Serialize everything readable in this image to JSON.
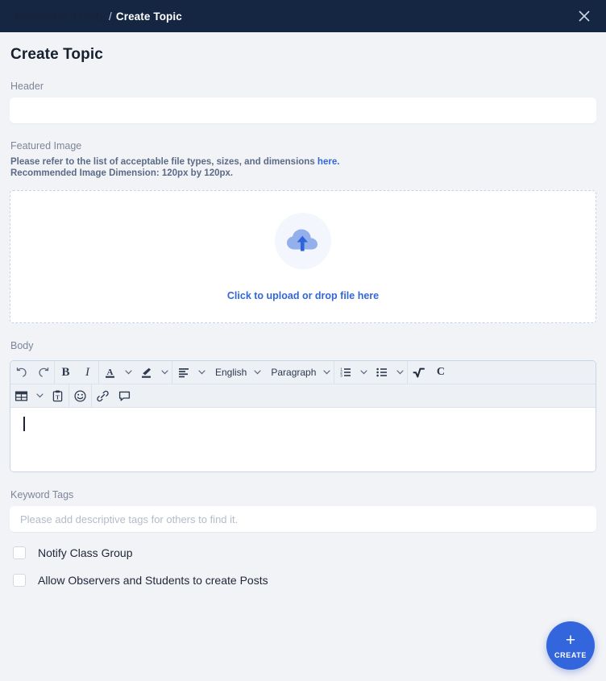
{
  "topbar": {
    "breadcrumb_parent": "Secondary 3 Unity",
    "breadcrumb_separator": "/",
    "breadcrumb_current": "Create Topic",
    "close_icon": "close-icon"
  },
  "page": {
    "title": "Create Topic"
  },
  "header_field": {
    "label": "Header",
    "value": "",
    "placeholder": ""
  },
  "featured_image": {
    "label": "Featured Image",
    "note_line1_prefix": "Please refer to the list of acceptable file types, sizes, and dimensions ",
    "note_link": "here.",
    "note_line2": "Recommended Image Dimension: 120px by 120px.",
    "dropzone_text": "Click to upload or drop file here",
    "upload_icon": "cloud-upload-icon"
  },
  "body_field": {
    "label": "Body",
    "value": "",
    "toolbar_row1": [
      {
        "name": "undo-button",
        "icon": "undo-icon",
        "kind": "icon"
      },
      {
        "name": "redo-button",
        "icon": "redo-icon",
        "kind": "icon"
      },
      {
        "name": "bold-button",
        "icon": "bold-icon",
        "kind": "text",
        "text": "B"
      },
      {
        "name": "italic-button",
        "icon": "italic-icon",
        "kind": "text",
        "text": "I"
      },
      {
        "name": "font-color-button",
        "icon": "font-color-icon",
        "kind": "icon",
        "has_chevron": true
      },
      {
        "name": "highlight-color-button",
        "icon": "highlighter-icon",
        "kind": "icon",
        "has_chevron": true
      },
      {
        "name": "align-button",
        "icon": "align-left-icon",
        "kind": "icon",
        "has_chevron": true
      },
      {
        "name": "language-dropdown",
        "kind": "label",
        "text": "English",
        "has_chevron": true
      },
      {
        "name": "paragraph-style-dropdown",
        "kind": "label",
        "text": "Paragraph",
        "has_chevron": true
      },
      {
        "name": "ordered-list-button",
        "icon": "ordered-list-icon",
        "kind": "icon",
        "has_chevron": true
      },
      {
        "name": "bullet-list-button",
        "icon": "bullet-list-icon",
        "kind": "icon",
        "has_chevron": true
      },
      {
        "name": "math-equation-button",
        "icon": "square-root-icon",
        "kind": "icon"
      },
      {
        "name": "chemistry-button",
        "icon": "chemistry-c-icon",
        "kind": "text",
        "text": "C"
      }
    ],
    "toolbar_row2": [
      {
        "name": "insert-table-button",
        "icon": "table-icon",
        "has_chevron": true
      },
      {
        "name": "paste-as-text-button",
        "icon": "clipboard-text-icon"
      },
      {
        "name": "emoji-button",
        "icon": "emoji-smiley-icon"
      },
      {
        "name": "insert-link-button",
        "icon": "link-icon"
      },
      {
        "name": "comment-button",
        "icon": "comment-bubble-icon"
      }
    ]
  },
  "keyword_tags": {
    "label": "Keyword Tags",
    "value": "",
    "placeholder": "Please add descriptive tags for others to find it."
  },
  "checkboxes": [
    {
      "name": "notify-class-group-checkbox",
      "label": "Notify Class Group",
      "checked": false
    },
    {
      "name": "allow-observers-students-checkbox",
      "label": "Allow Observers and Students to create Posts",
      "checked": false
    }
  ],
  "fab": {
    "plus": "+",
    "label": "CREATE",
    "color": "#3366dd"
  },
  "colors": {
    "topbar_bg": "#152642",
    "page_bg": "#f2f3f7",
    "accent_blue": "#3467d6",
    "toolbar_bg": "#edf0f5",
    "label_gray": "#7c8699"
  }
}
